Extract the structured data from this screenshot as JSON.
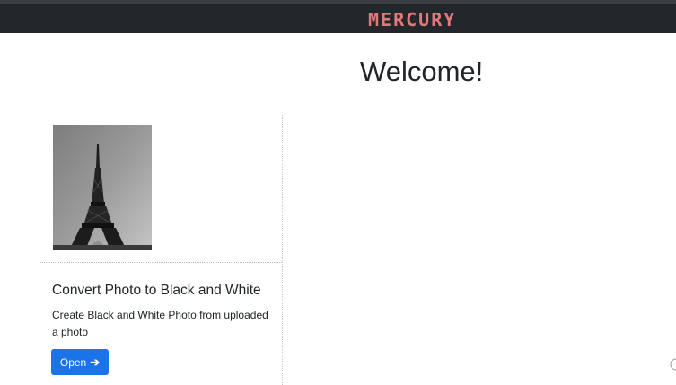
{
  "header": {
    "brand": "MERCURY",
    "brand_color": "#e07a7a",
    "background": "#23262b"
  },
  "main": {
    "title": "Welcome!"
  },
  "cards": [
    {
      "image_icon": "eiffel-tower-photo",
      "title": "Convert Photo to Black and White",
      "description": "Create Black and White Photo from uploaded a photo",
      "button_label": "Open",
      "button_icon": "arrow-right-icon",
      "button_color": "#1a73e8"
    }
  ]
}
